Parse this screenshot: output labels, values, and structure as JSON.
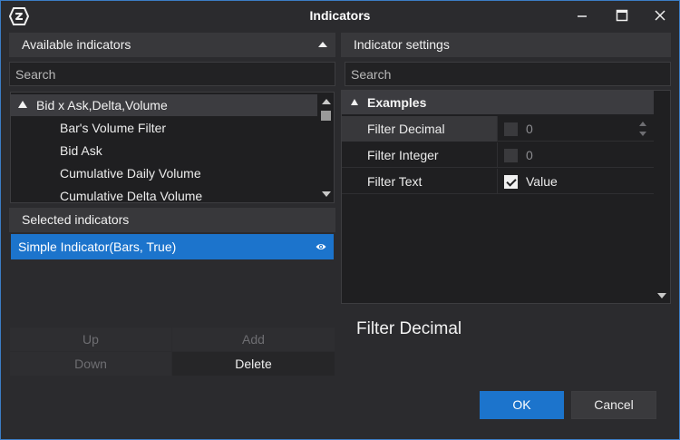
{
  "window": {
    "title": "Indicators"
  },
  "available": {
    "header": "Available indicators",
    "search_placeholder": "Search",
    "group": "Bid x Ask,Delta,Volume",
    "items": [
      "Bar's Volume Filter",
      "Bid Ask",
      "Cumulative Daily Volume",
      "Cumulative Delta Volume"
    ]
  },
  "selected": {
    "header": "Selected indicators",
    "items": [
      {
        "label": "Simple Indicator(Bars, True)",
        "visible": true
      }
    ],
    "buttons": {
      "up": "Up",
      "add": "Add",
      "down": "Down",
      "delete": "Delete"
    }
  },
  "settings": {
    "header": "Indicator settings",
    "search_placeholder": "Search",
    "category": "Examples",
    "properties": [
      {
        "name": "Filter Decimal",
        "checked": false,
        "value": "0"
      },
      {
        "name": "Filter Integer",
        "checked": false,
        "value": "0"
      },
      {
        "name": "Filter Text",
        "checked": true,
        "value": "Value"
      }
    ],
    "description_title": "Filter Decimal"
  },
  "dialog": {
    "ok": "OK",
    "cancel": "Cancel"
  },
  "colors": {
    "accent": "#1c74cc",
    "border": "#3b7cc4",
    "background": "#2b2b2e"
  }
}
